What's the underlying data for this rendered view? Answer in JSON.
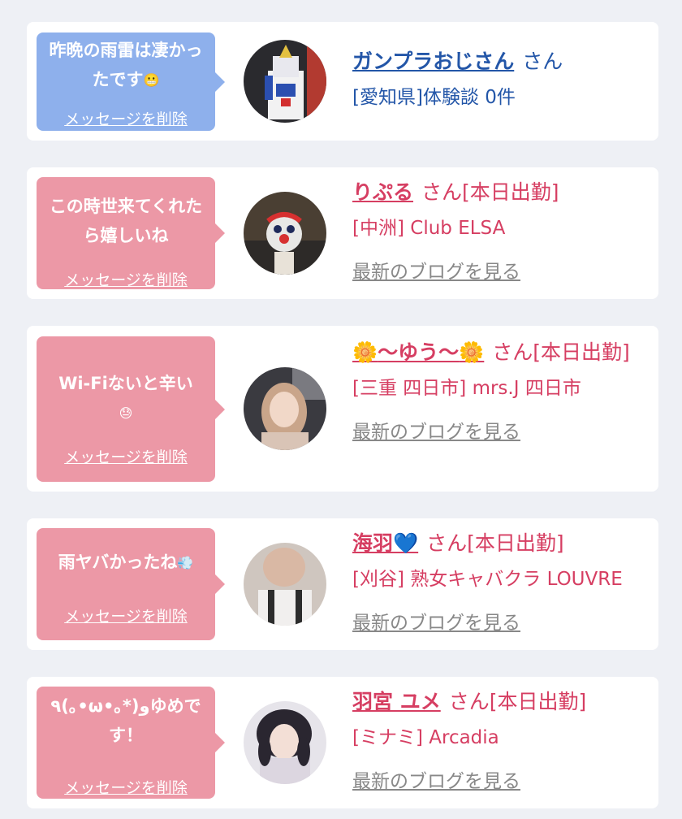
{
  "messages": [
    {
      "message": "昨晩の雨雷は凄かったです",
      "message_emoji": "😬",
      "delete_label": "メッセージを削除",
      "name": "ガンプラおじさん",
      "suffix": "さん",
      "detail": "[愛知県]体験談 0件",
      "blog_label": ""
    },
    {
      "message": "この時世来てくれたら嬉しいね",
      "delete_label": "メッセージを削除",
      "name": "りぷる",
      "suffix": "さん[本日出勤]",
      "detail": "[中洲] Club ELSA",
      "blog_label": "最新のブログを見る"
    },
    {
      "message": "Wi-Fiないと辛い",
      "message_emoji": "😓",
      "delete_label": "メッセージを削除",
      "name_prefix_icon": "🌼",
      "name": "〜ゆう〜",
      "name_suffix_icon": "🌼",
      "suffix": "さん[本日出勤]",
      "detail": "[三重 四日市] mrs.J 四日市",
      "blog_label": "最新のブログを見る"
    },
    {
      "message": "雨ヤバかったね",
      "message_emoji": "💨",
      "delete_label": "メッセージを削除",
      "name": "海羽",
      "name_suffix_icon": "💙",
      "suffix": "さん[本日出勤]",
      "detail": "[刈谷] 熟女キャバクラ LOUVRE",
      "blog_label": "最新のブログを見る"
    },
    {
      "message": "٩(｡•ω•｡*)وゆめです！",
      "delete_label": "メッセージを削除",
      "name": "羽宮 ユメ",
      "suffix": "さん[本日出勤]",
      "detail": "[ミナミ] Arcadia",
      "blog_label": "最新のブログを見る"
    }
  ]
}
